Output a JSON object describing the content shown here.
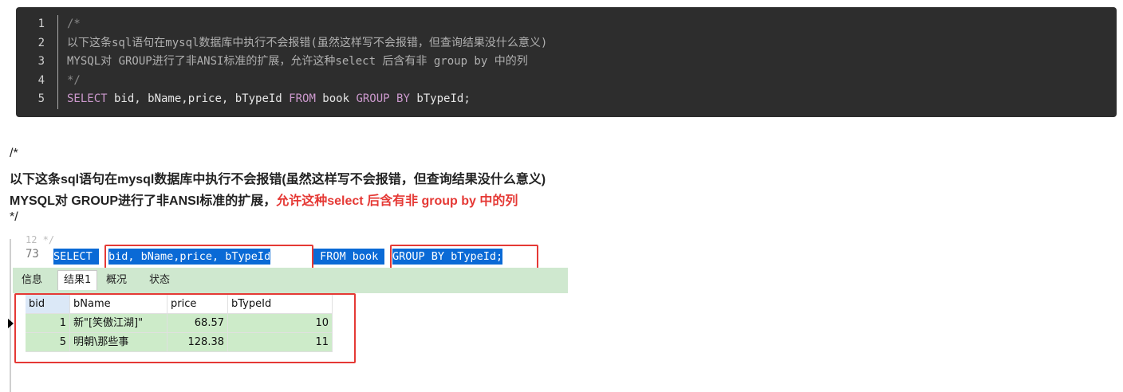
{
  "code": {
    "line_numbers": [
      "1",
      "2",
      "3",
      "4",
      "5"
    ],
    "comment_open": "/*",
    "comment_line2": "以下这条sql语句在mysql数据库中执行不会报错(虽然这样写不会报错，但查询结果没什么意义)",
    "comment_line3": "MYSQL对 GROUP进行了非ANSI标准的扩展，允许这种select 后含有非 group by 中的列",
    "comment_close": "*/",
    "sql_select": "SELECT",
    "sql_cols": " bid, bName,price, bTypeId ",
    "sql_from": "FROM",
    "sql_table": " book ",
    "sql_group": "GROUP BY",
    "sql_end": " bTypeId;"
  },
  "explain": {
    "open": "/*",
    "line1": "以下这条sql语句在mysql数据库中执行不会报错(虽然这样写不会报错，但查询结果没什么意义)",
    "line2_black": "MYSQL对 GROUP进行了非ANSI标准的扩展，",
    "line2_red": "允许这种select 后含有非 group by 中的列",
    "close": "*/"
  },
  "screenshot": {
    "prev_line": "12  */",
    "line_number": "73",
    "sel_select": "SELECT ",
    "sel_cols": "bid, bName,price, bTypeId",
    "sel_from": " FROM book ",
    "sel_group": "GROUP BY bTypeId;",
    "tabs": [
      "信息",
      "结果1",
      "概况",
      "状态"
    ],
    "columns": [
      "bid",
      "bName",
      "price",
      "bTypeId"
    ],
    "rows": [
      [
        "1",
        "新\"[笑傲江湖]\"",
        "68.57",
        "10"
      ],
      [
        "5",
        "明朝\\那些事",
        "128.38",
        "11"
      ]
    ]
  },
  "colors": {
    "highlight": "#e53935",
    "selection": "#0a6ad6",
    "result_bg": "#cdebc9",
    "tabbar_bg": "#cfe8cf"
  }
}
